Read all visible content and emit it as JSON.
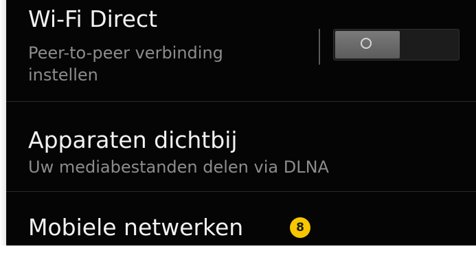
{
  "settings": {
    "items": [
      {
        "title": "Wi-Fi Direct",
        "subtitle": "Peer-to-peer verbinding instellen"
      },
      {
        "title": "Apparaten dichtbij",
        "subtitle": "Uw mediabestanden delen via DLNA"
      },
      {
        "title": "Mobiele netwerken"
      }
    ],
    "wifi_direct_toggle": {
      "state": "off",
      "icon": "power-off-ring-icon"
    },
    "callout_badge": {
      "number": "8",
      "color": "#f7c600"
    }
  }
}
